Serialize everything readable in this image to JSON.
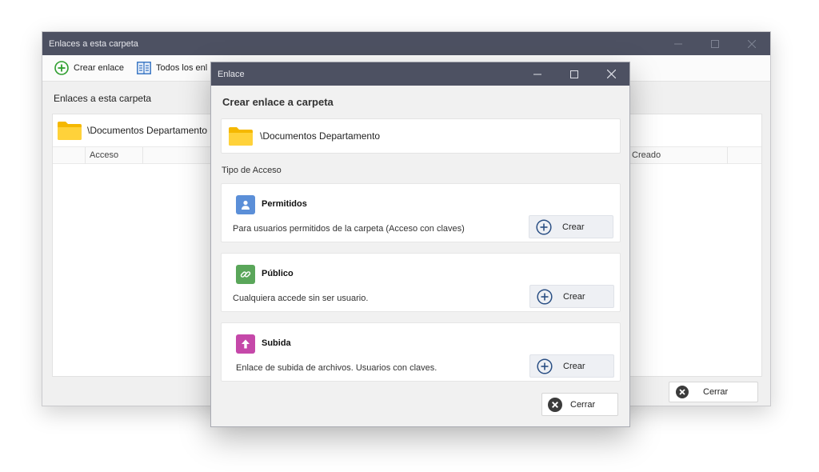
{
  "back_window": {
    "title": "Enlaces a esta carpeta",
    "toolbar": {
      "create_link": "Crear enlace",
      "all_links": "Todos los enl"
    },
    "section_title": "Enlaces a esta carpeta",
    "folder_path": "\\Documentos Departamento",
    "columns": {
      "access": "Acceso",
      "created": "Creado"
    },
    "close_label": "Cerrar"
  },
  "dialog": {
    "title": "Enlace",
    "heading": "Crear enlace a carpeta",
    "folder_path": "\\Documentos Departamento",
    "access_type_label": "Tipo de Acceso",
    "options": [
      {
        "name": "Permitidos",
        "description": "Para usuarios permitidos de la carpeta (Acceso con claves)",
        "button": "Crear",
        "icon": "user-icon",
        "color": "#5b8fd8"
      },
      {
        "name": "Público",
        "description": "Cualquiera accede sin ser usuario.",
        "button": "Crear",
        "icon": "link-icon",
        "color": "#5aa65a"
      },
      {
        "name": "Subida",
        "description": "Enlace de subida de archivos. Usuarios con claves.",
        "button": "Crear",
        "icon": "upload-arrow-icon",
        "color": "#c548a9"
      }
    ],
    "close_label": "Cerrar"
  }
}
